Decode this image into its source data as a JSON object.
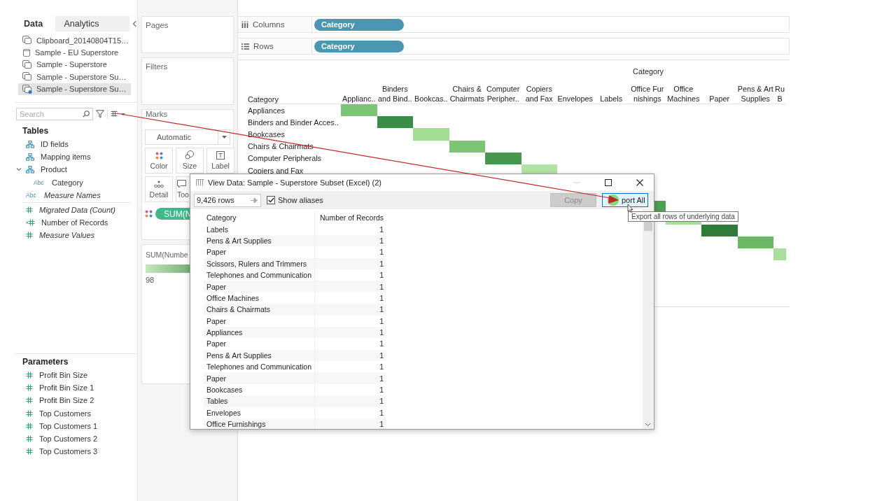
{
  "sidebar": {
    "tabs": [
      {
        "label": "Data",
        "selected": true
      },
      {
        "label": "Analytics",
        "selected": false
      }
    ],
    "data_sources": [
      {
        "label": "Clipboard_20140804T15…",
        "kind": "extract",
        "selected": false
      },
      {
        "label": "Sample - EU Superstore",
        "kind": "database",
        "selected": false
      },
      {
        "label": "Sample - Superstore",
        "kind": "extract",
        "selected": false
      },
      {
        "label": "Sample - Superstore Su…",
        "kind": "extract",
        "selected": false
      },
      {
        "label": "Sample - Superstore Su…",
        "kind": "extract-active",
        "selected": true
      }
    ],
    "search": {
      "placeholder": "Search"
    },
    "tables": {
      "title": "Tables",
      "items": [
        {
          "label": "ID fields",
          "kind": "hierarchy",
          "italic": false
        },
        {
          "label": "Mapping items",
          "kind": "hierarchy",
          "italic": false
        },
        {
          "label": "Product",
          "kind": "hierarchy",
          "italic": false,
          "expanded": true,
          "children": [
            {
              "label": "Category",
              "kind": "dimension",
              "type_icon": "Abc",
              "italic": false
            }
          ]
        },
        {
          "label": "Measure Names",
          "kind": "dimension",
          "type_icon": "Abc",
          "italic": true
        },
        {
          "label": "Migrated Data (Count)",
          "kind": "measure",
          "italic": true
        },
        {
          "label": "Number of Records",
          "kind": "calc-measure",
          "italic": false
        },
        {
          "label": "Measure Values",
          "kind": "measure",
          "italic": true
        }
      ]
    },
    "parameters": {
      "title": "Parameters",
      "items": [
        "Profit Bin Size",
        "Profit Bin Size 1",
        "Profit Bin Size 2",
        "Top Customers",
        "Top Customers 1",
        "Top Customers 2",
        "Top Customers 3"
      ]
    }
  },
  "cards": {
    "pages": {
      "title": "Pages"
    },
    "filters": {
      "title": "Filters"
    },
    "marks": {
      "title": "Marks",
      "mark_type": "Automatic",
      "buttons": [
        {
          "label": "Color",
          "kind": "color"
        },
        {
          "label": "Size",
          "kind": "size"
        },
        {
          "label": "Label",
          "kind": "label"
        },
        {
          "label": "Detail",
          "kind": "detail"
        },
        {
          "label": "Too",
          "kind": "tooltip"
        }
      ],
      "pills": [
        {
          "label": "SUM(N",
          "kind": "color"
        }
      ]
    },
    "legend": {
      "title": "SUM(Numbe",
      "min_label": "98"
    }
  },
  "columns_shelf": {
    "label": "Columns",
    "pills": [
      "Category"
    ]
  },
  "rows_shelf": {
    "label": "Rows",
    "pills": [
      "Category"
    ]
  },
  "view": {
    "title": "Category",
    "row_header": "Category",
    "columns": [
      "Applianc..",
      "Binders and Bind..",
      "Bookcas..",
      "Chairs & Chairmats",
      "Computer Peripher..",
      "Copiers and Fax",
      "Envelopes",
      "Labels",
      "Office Fur nishings",
      "Office Machines",
      "Paper",
      "Pens & Art Supplies",
      "Ru B"
    ],
    "rows": [
      "Appliances",
      "Binders and Binder Acces..",
      "Bookcases",
      "Chairs & Chairmats",
      "Computer Peripherals",
      "Copiers and Fax"
    ],
    "marks": [
      {
        "color": "#7cc576"
      },
      {
        "color": "#3b8c46"
      },
      {
        "color": "#a3dc93"
      },
      {
        "color": "#7cc576"
      },
      {
        "color": "#47974f"
      },
      {
        "color": "#b3e2a5"
      }
    ],
    "marks_lower": [
      {
        "color": "#4f9f52"
      },
      {
        "color": "#a9dd9a"
      },
      {
        "color": "#2f7c3b"
      },
      {
        "color": "#6ab764"
      },
      {
        "color": "#a9de9b"
      }
    ]
  },
  "dialog": {
    "title": "View Data: Sample - Superstore Subset (Excel) (2)",
    "rows_field": "9,426 rows",
    "show_aliases": {
      "label": "Show aliases",
      "checked": true
    },
    "buttons": [
      {
        "label": "Copy",
        "disabled": true
      },
      {
        "label": "port All",
        "disabled": false
      }
    ],
    "tooltip": "Export all rows of underlying data",
    "table": {
      "columns": [
        "Category",
        "Number of Records"
      ],
      "rows": [
        [
          "Labels",
          "1"
        ],
        [
          "Pens & Art Supplies",
          "1"
        ],
        [
          "Paper",
          "1"
        ],
        [
          "Scissors, Rulers and Trimmers",
          "1"
        ],
        [
          "Telephones and Communication",
          "1"
        ],
        [
          "Paper",
          "1"
        ],
        [
          "Office Machines",
          "1"
        ],
        [
          "Chairs & Chairmats",
          "1"
        ],
        [
          "Paper",
          "1"
        ],
        [
          "Appliances",
          "1"
        ],
        [
          "Paper",
          "1"
        ],
        [
          "Pens & Art Supplies",
          "1"
        ],
        [
          "Telephones and Communication",
          "1"
        ],
        [
          "Paper",
          "1"
        ],
        [
          "Bookcases",
          "1"
        ],
        [
          "Tables",
          "1"
        ],
        [
          "Envelopes",
          "1"
        ],
        [
          "Office Furnishings",
          "1"
        ]
      ]
    }
  }
}
